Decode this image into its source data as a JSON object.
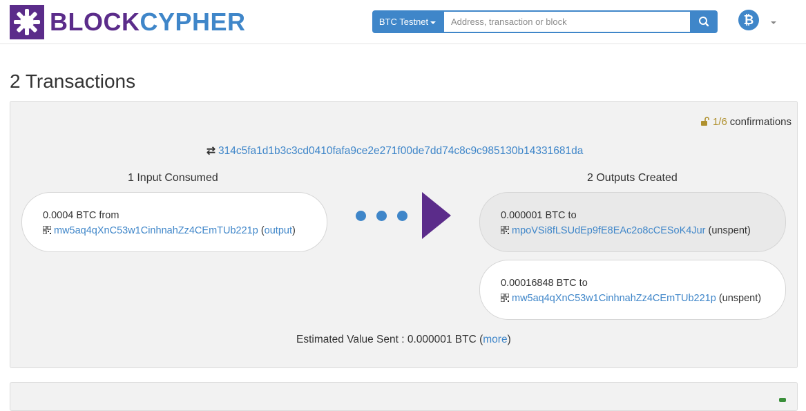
{
  "header": {
    "logo_part1": "BLOCK",
    "logo_part2": "CYPHER",
    "network_label": "BTC Testnet",
    "search_placeholder": "Address, transaction or block",
    "search_icon": "search-icon",
    "currency_icon": "bitcoin-icon",
    "brand_colors": {
      "purple": "#5b2c8a",
      "blue": "#3f86c9"
    }
  },
  "page": {
    "title": "2 Transactions"
  },
  "transaction": {
    "confirmations_fraction": "1/6",
    "confirmations_label": "confirmations",
    "hash": "314c5fa1d1b3c3cd0410fafa9ce2e271f00de7dd74c8c9c985130b14331681da",
    "inputs_header": "1 Input Consumed",
    "outputs_header": "2 Outputs Created",
    "inputs": [
      {
        "amount_text": "0.0004 BTC from",
        "address": "mw5aq4qXnC53w1CinhnahZz4CEmTUb221p",
        "link_label": "output"
      }
    ],
    "outputs": [
      {
        "amount_text": "0.000001 BTC to",
        "address": "mpoVSi8fLSUdEp9fE8EAc2o8cCESoK4Jur",
        "status": "unspent"
      },
      {
        "amount_text": "0.00016848 BTC to",
        "address": "mw5aq4qXnC53w1CinhnahZz4CEmTUb221p",
        "status": "unspent"
      }
    ],
    "estimated_label": "Estimated Value Sent : 0.000001 BTC",
    "more_label": "more"
  }
}
